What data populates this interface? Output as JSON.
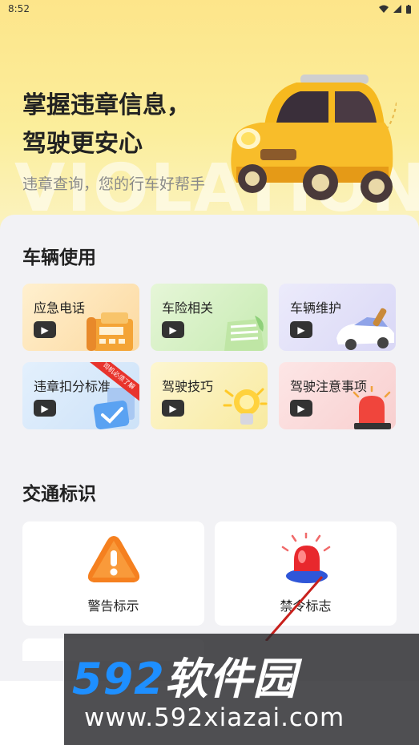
{
  "status_bar": {
    "time": "8:52"
  },
  "hero": {
    "title_line1": "掌握违章信息，",
    "title_line2": "驾驶更安心",
    "subtitle": "违章查询，您的行车好帮手",
    "background_text": "VIOLATION"
  },
  "vehicle_section": {
    "title": "车辆使用",
    "cards": [
      {
        "label": "应急电话",
        "color": "#fde2b4"
      },
      {
        "label": "车险相关",
        "color": "#d8f0c6"
      },
      {
        "label": "车辆维护",
        "color": "#e2e0f8"
      },
      {
        "label": "违章扣分标准",
        "color": "#d6e9fb",
        "ribbon": "司机必须了解"
      },
      {
        "label": "驾驶技巧",
        "color": "#fbf1b8"
      },
      {
        "label": "驾驶注意事项",
        "color": "#fbdada"
      }
    ],
    "arrow_glyph": "▶"
  },
  "traffic_section": {
    "title": "交通标识",
    "cards": [
      {
        "label": "警告标示",
        "icon": "warning-triangle-icon"
      },
      {
        "label": "禁令标志",
        "icon": "siren-icon"
      }
    ]
  },
  "watermark": {
    "number": "592",
    "name": "软件园",
    "url": "www.592xiazai.com",
    "accent": "#1e8fff"
  }
}
